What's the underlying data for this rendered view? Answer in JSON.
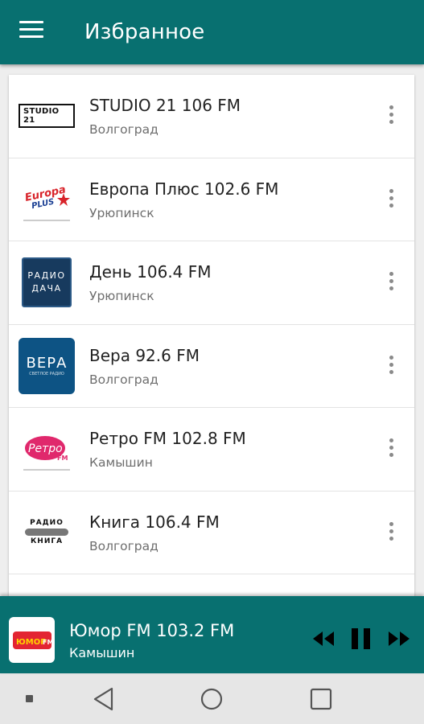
{
  "appbar": {
    "title": "Избранное",
    "menu_icon": "hamburger-menu-icon"
  },
  "stations": [
    {
      "name": "STUDIO 21 106 FM",
      "city": "Волгоград",
      "logo": "studio21-logo",
      "logo_text": "STUDIO 21"
    },
    {
      "name": "Европа Плюс 102.6 FM",
      "city": "Урюпинск",
      "logo": "europa-plus-logo",
      "logo_text": "Europa PLUS"
    },
    {
      "name": "День 106.4 FM",
      "city": "Урюпинск",
      "logo": "radio-dacha-logo",
      "logo_text": "РАДИО ДАЧА"
    },
    {
      "name": "Вера 92.6 FM",
      "city": "Волгоград",
      "logo": "vera-logo",
      "logo_text": "ВЕРА"
    },
    {
      "name": "Ретро FM 102.8 FM",
      "city": "Камышин",
      "logo": "retro-fm-logo",
      "logo_text": "Ретро FM"
    },
    {
      "name": "Книга 106.4 FM",
      "city": "Волгоград",
      "logo": "radio-kniga-logo",
      "logo_text": "РАДИО КНИГА"
    }
  ],
  "player": {
    "title": "Юмор FM 103.2 FM",
    "city": "Камышин",
    "logo_text": "ЮМОР FM",
    "state": "playing"
  },
  "colors": {
    "primary": "#087070",
    "background": "#eeeeee",
    "europa_red": "#d8232a",
    "retro_pink": "#e0286c",
    "vera_blue": "#0d5384",
    "dacha_blue": "#173a5e"
  }
}
